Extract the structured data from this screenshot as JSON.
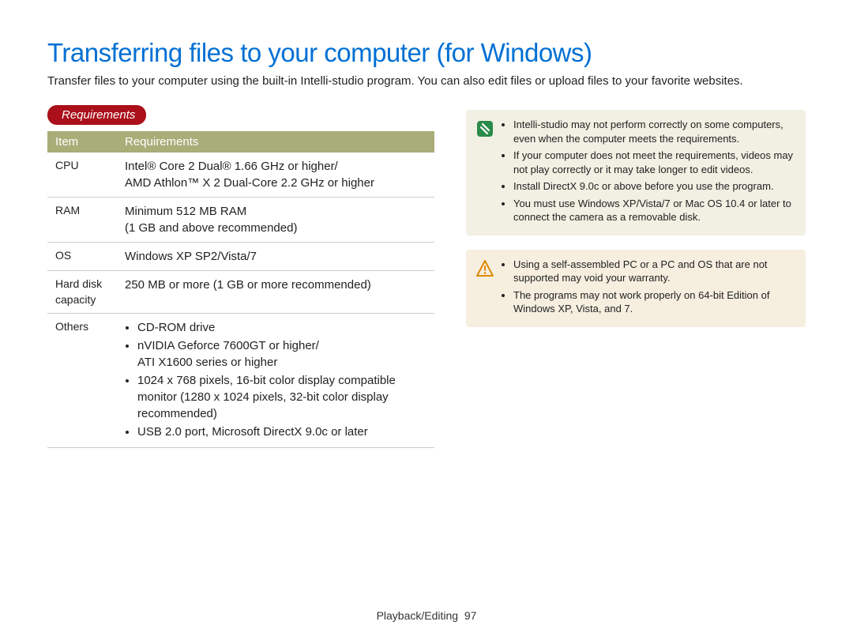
{
  "title": "Transferring files to your computer (for Windows)",
  "intro": "Transfer files to your computer using the built-in Intelli-studio program. You can also edit files or upload files to your favorite websites.",
  "requirements_label": "Requirements",
  "table": {
    "headers": {
      "item": "Item",
      "req": "Requirements"
    },
    "rows": [
      {
        "item": "CPU",
        "req": "Intel® Core 2 Dual® 1.66 GHz or higher/\nAMD Athlon™ X 2 Dual-Core 2.2 GHz or higher"
      },
      {
        "item": "RAM",
        "req": "Minimum 512 MB RAM\n(1 GB and above recommended)"
      },
      {
        "item": "OS",
        "req": "Windows XP SP2/Vista/7"
      },
      {
        "item": "Hard disk capacity",
        "req": "250 MB or more (1 GB or more recommended)"
      },
      {
        "item": "Others",
        "others": [
          "CD-ROM drive",
          "nVIDIA Geforce 7600GT or higher/\nATI X1600 series or higher",
          "1024 x 768 pixels, 16-bit color display compatible monitor (1280 x 1024 pixels, 32-bit color display recommended)",
          "USB 2.0 port, Microsoft DirectX 9.0c or later"
        ]
      }
    ]
  },
  "info_notes": [
    "Intelli-studio may not perform correctly on some computers, even when the computer meets the requirements.",
    "If your computer does not meet the requirements, videos may not play correctly or it may take longer to edit videos.",
    "Install DirectX 9.0c or above before you use the program.",
    "You must use Windows XP/Vista/7 or Mac OS 10.4 or later to connect the camera as a removable disk."
  ],
  "warn_notes": [
    "Using a self-assembled PC or a PC and OS that are not supported may void your warranty.",
    "The programs may not work properly on 64-bit Edition of Windows XP, Vista, and 7."
  ],
  "footer": {
    "section": "Playback/Editing",
    "page": "97"
  }
}
